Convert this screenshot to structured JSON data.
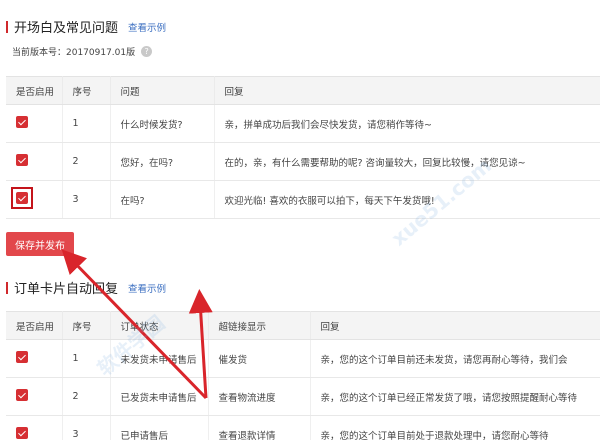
{
  "section1": {
    "title": "开场白及常见问题",
    "example_link": "查看示例"
  },
  "version": {
    "label": "当前版本号：20170917.01版",
    "help_icon": "question-icon"
  },
  "table1": {
    "headers": [
      "是否启用",
      "序号",
      "问题",
      "回复"
    ],
    "rows": [
      {
        "enabled": true,
        "no": "1",
        "question": "什么时候发货?",
        "reply": "亲，拼单成功后我们会尽快发货，请您稍作等待~"
      },
      {
        "enabled": true,
        "no": "2",
        "question": "您好，在吗?",
        "reply": "在的，亲，有什么需要帮助的呢? 咨询量较大，回复比较慢，请您见谅~"
      },
      {
        "enabled": true,
        "no": "3",
        "question": "在吗?",
        "reply": "欢迎光临! 喜欢的衣服可以拍下，每天下午发货哦!"
      }
    ]
  },
  "save_button": {
    "label": "保存并发布"
  },
  "section2": {
    "title": "订单卡片自动回复",
    "example_link": "查看示例"
  },
  "table2": {
    "headers": [
      "是否启用",
      "序号",
      "订单状态",
      "超链接显示",
      "回复"
    ],
    "rows": [
      {
        "enabled": true,
        "no": "1",
        "status": "未发货未申请售后",
        "link_text": "催发货",
        "reply": "亲，您的这个订单目前还未发货，请您再耐心等待，我们会"
      },
      {
        "enabled": true,
        "no": "2",
        "status": "已发货未申请售后",
        "link_text": "查看物流进度",
        "reply": "亲，您的这个订单已经正常发货了哦，请您按照提醒耐心等待"
      },
      {
        "enabled": true,
        "no": "3",
        "status": "已申请售后",
        "link_text": "查看退款详情",
        "reply": "亲，您的这个订单目前处于退款处理中，请您耐心等待"
      }
    ]
  },
  "colors": {
    "accent": "#d62f33",
    "button": "#e2474b",
    "link": "#3a6ec0",
    "arrow": "#d9252b"
  },
  "watermark": [
    "xue51.com",
    "软件学园"
  ]
}
